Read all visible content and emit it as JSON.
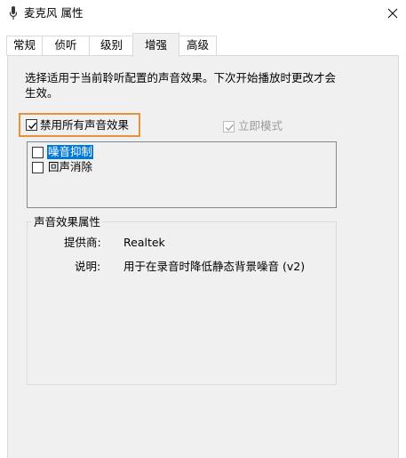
{
  "window": {
    "title": "麦克风 属性",
    "icon": "microphone-icon",
    "close_icon": "close-icon"
  },
  "tabs": [
    {
      "label": "常规",
      "active": false
    },
    {
      "label": "侦听",
      "active": false
    },
    {
      "label": "级别",
      "active": false
    },
    {
      "label": "增强",
      "active": true
    },
    {
      "label": "高级",
      "active": false
    }
  ],
  "enhancements": {
    "description": "选择适用于当前聆听配置的声音效果。下次开始播放时更改才会生效。",
    "disable_all": {
      "label": "禁用所有声音效果",
      "checked": true
    },
    "immediate_mode": {
      "label": "立即模式",
      "checked": true,
      "disabled": true
    },
    "effects": [
      {
        "label": "噪音抑制",
        "checked": false,
        "selected": true
      },
      {
        "label": "回声消除",
        "checked": false,
        "selected": false
      }
    ],
    "properties": {
      "title": "声音效果属性",
      "provider_label": "提供商:",
      "provider_value": "Realtek",
      "description_label": "说明:",
      "description_value": "用于在录音时降低静态背景噪音 (v2)"
    }
  },
  "colors": {
    "highlight_border": "#e8923a",
    "selection": "#0078d7",
    "panel_bg": "#f0f0f0"
  }
}
